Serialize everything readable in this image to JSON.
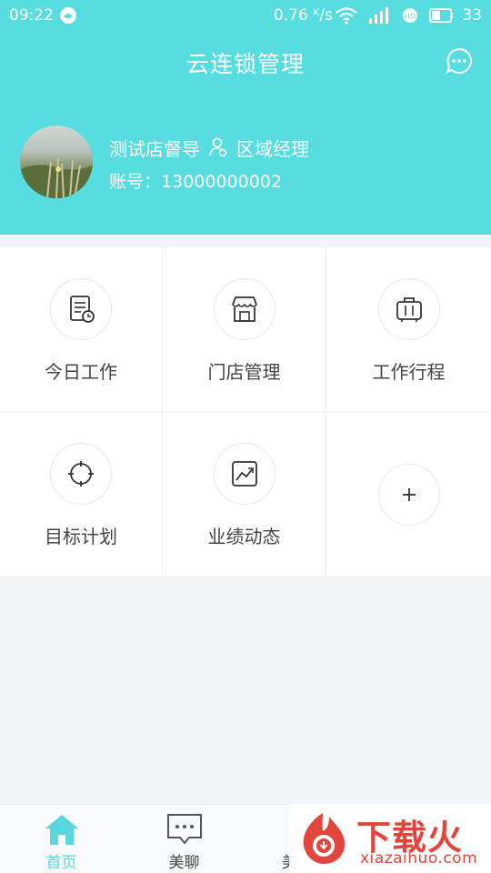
{
  "status_bar": {
    "time": "09:22",
    "speed": "0.76 ᴷ/s",
    "battery": "33",
    "icons": [
      "app-icon",
      "wifi-icon",
      "signal-icon",
      "hd-icon",
      "battery-icon"
    ]
  },
  "header": {
    "title": "云连锁管理",
    "chat_icon": "chat-bubble-icon"
  },
  "profile": {
    "name": "测试店督导",
    "role": "区域经理",
    "account_label": "账号：",
    "account": "13000000002"
  },
  "grid": {
    "items": [
      {
        "label": "今日工作",
        "icon": "today-work-icon"
      },
      {
        "label": "门店管理",
        "icon": "store-icon"
      },
      {
        "label": "工作行程",
        "icon": "luggage-icon"
      },
      {
        "label": "目标计划",
        "icon": "target-icon"
      },
      {
        "label": "业绩动态",
        "icon": "trend-chart-icon"
      },
      {
        "label": "",
        "icon": "plus-icon"
      }
    ]
  },
  "tabbar": {
    "tabs": [
      {
        "label": "首页",
        "icon": "home-icon",
        "active": true
      },
      {
        "label": "美聊",
        "icon": "message-icon",
        "active": false
      },
      {
        "label": "美",
        "icon": "tab-icon",
        "active": false
      }
    ]
  },
  "watermark": {
    "brand": "下载火",
    "domain": "xiazaihuo.com"
  },
  "colors": {
    "accent": "#57dde0",
    "tab_active": "#57d6db",
    "text": "#444444",
    "brand_red": "#e2453b"
  }
}
